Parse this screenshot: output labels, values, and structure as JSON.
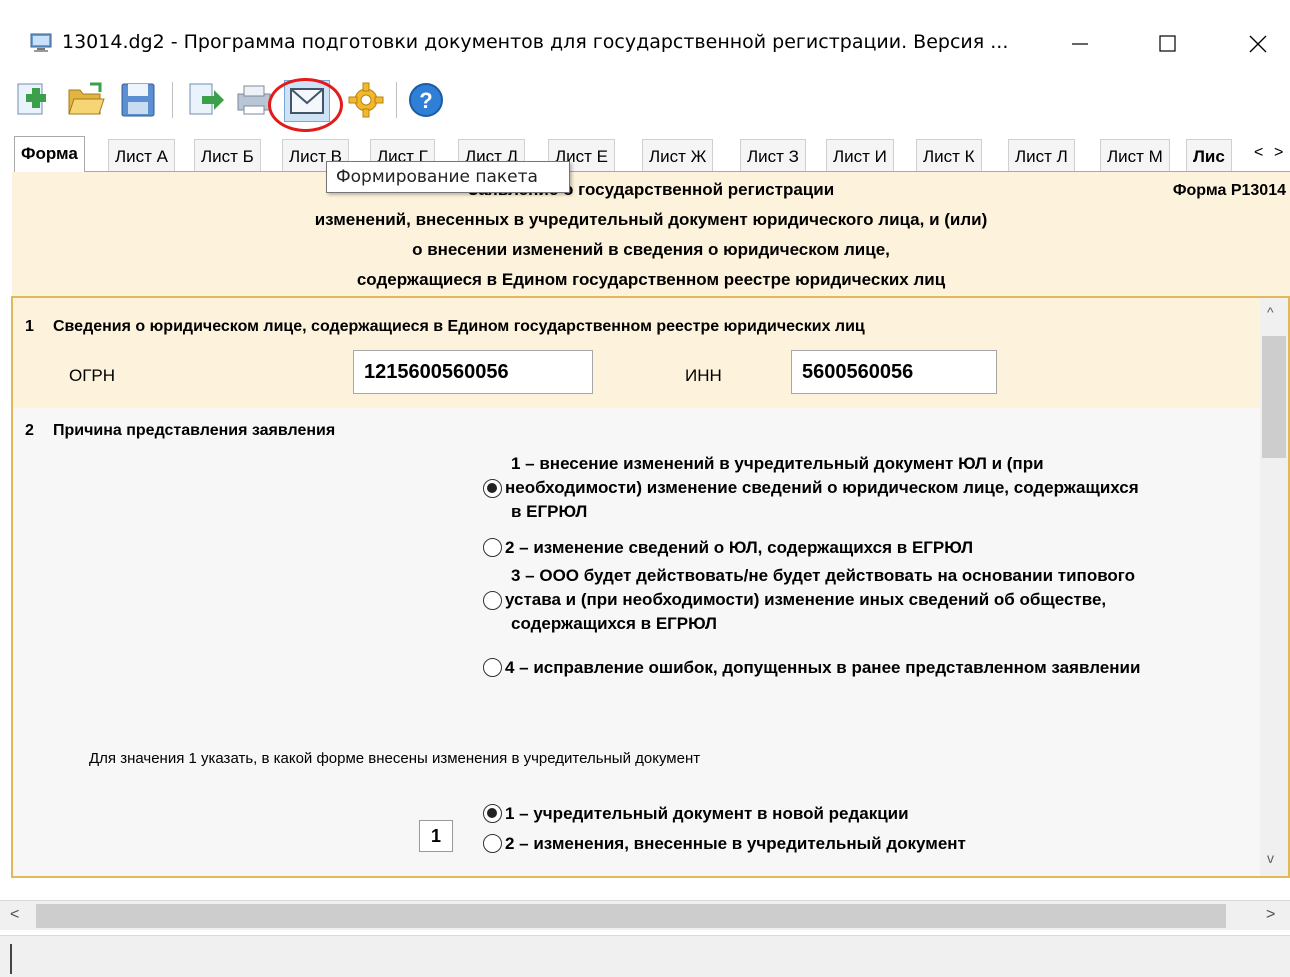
{
  "window": {
    "title": "13014.dg2 - Программа подготовки документов для государственной регистрации. Версия ...",
    "controls": [
      "minimize",
      "maximize",
      "close"
    ]
  },
  "toolbar": {
    "buttons": [
      {
        "name": "new-document",
        "icon": "plus-icon"
      },
      {
        "name": "open",
        "icon": "folder-open-icon"
      },
      {
        "name": "save",
        "icon": "floppy-icon"
      },
      {
        "name": "export",
        "icon": "export-arrow-icon"
      },
      {
        "name": "print",
        "icon": "printer-icon"
      },
      {
        "name": "form-package",
        "icon": "envelope-icon"
      },
      {
        "name": "settings",
        "icon": "gear-icon"
      },
      {
        "name": "help",
        "icon": "question-icon"
      }
    ],
    "tooltip": "Формирование пакета"
  },
  "tabs": [
    "Форма",
    "Лист А",
    "Лист Б",
    "Лист В",
    "Лист Г",
    "Лист Д",
    "Лист Е",
    "Лист Ж",
    "Лист З",
    "Лист И",
    "Лист К",
    "Лист Л",
    "Лист М",
    "Лис"
  ],
  "active_tab": "Форма",
  "header": {
    "line1": "Заявление о государственной регистрации",
    "line2": "изменений, внесенных в учредительный документ юридического лица, и (или)",
    "line3": "о внесении изменений в сведения о юридическом лице,",
    "line4": "содержащиеся в Едином государственном реестре юридических лиц",
    "form_code": "Форма Р13014"
  },
  "section1": {
    "number": "1",
    "title": "Сведения о юридическом лице, содержащиеся в Едином государственном реестре юридических лиц",
    "ogrn_label": "ОГРН",
    "ogrn_value": "1215600560056",
    "inn_label": "ИНН",
    "inn_value": "5600560056"
  },
  "section2": {
    "number": "2",
    "title": "Причина представления заявления",
    "options": [
      {
        "line1": "1 – внесение изменений в учредительный документ ЮЛ и (при",
        "line2": "необходимости) изменение сведений о юридическом лице, содержащихся",
        "line3": "в ЕГРЮЛ",
        "selected": true
      },
      {
        "line1": "2 – изменение сведений о ЮЛ, содержащихся в ЕГРЮЛ",
        "selected": false
      },
      {
        "line1": "3 – ООО будет действовать/не будет действовать на основании типового",
        "line2": "устава и (при необходимости) изменение иных сведений об обществе,",
        "line3": "содержащихся в ЕГРЮЛ",
        "selected": false
      },
      {
        "line1": "4 – исправление ошибок, допущенных в ранее представленном заявлении",
        "selected": false
      }
    ],
    "subnote": "Для значения 1 указать, в какой форме внесены изменения в учредительный документ",
    "sub_value": "1",
    "sub_options": [
      {
        "label": "1 – учредительный документ в новой редакции",
        "selected": true
      },
      {
        "label": "2 – изменения, внесенные в учредительный документ",
        "selected": false
      }
    ]
  },
  "scroll": {
    "up": "^",
    "down": "v",
    "left": "<",
    "right": ">"
  },
  "colors": {
    "banner_bg": "#fdf2db",
    "frame_border": "#e2b95a",
    "highlight_ring": "#e31b1b"
  }
}
